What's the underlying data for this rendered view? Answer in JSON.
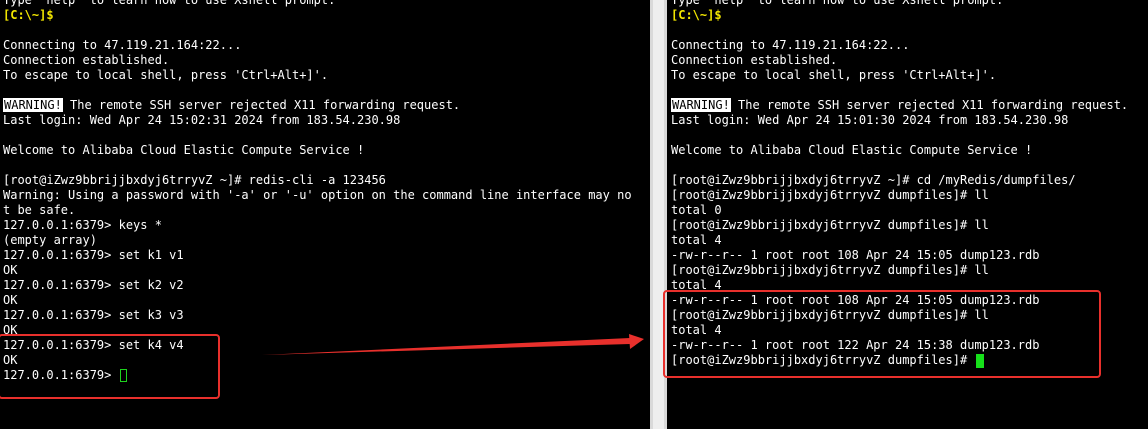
{
  "left_terminal": {
    "lines": [
      {
        "text": "Type `help' to learn how to use Xshell prompt."
      },
      {
        "text": "[C:\\~]$",
        "style": "prompt"
      },
      {
        "text": ""
      },
      {
        "text": "Connecting to 47.119.21.164:22..."
      },
      {
        "text": "Connection established."
      },
      {
        "text": "To escape to local shell, press 'Ctrl+Alt+]'."
      },
      {
        "text": ""
      },
      {
        "warning": "WARNING!",
        "text": " The remote SSH server rejected X11 forwarding request."
      },
      {
        "text": "Last login: Wed Apr 24 15:02:31 2024 from 183.54.230.98"
      },
      {
        "text": ""
      },
      {
        "text": "Welcome to Alibaba Cloud Elastic Compute Service !"
      },
      {
        "text": ""
      },
      {
        "text": "[root@iZwz9bbrijjbxdyj6trryvZ ~]# redis-cli -a 123456"
      },
      {
        "text": "Warning: Using a password with '-a' or '-u' option on the command line interface may no"
      },
      {
        "text": "t be safe."
      },
      {
        "text": "127.0.0.1:6379> keys *"
      },
      {
        "text": "(empty array)"
      },
      {
        "text": "127.0.0.1:6379> set k1 v1"
      },
      {
        "text": "OK"
      },
      {
        "text": "127.0.0.1:6379> set k2 v2"
      },
      {
        "text": "OK"
      },
      {
        "text": "127.0.0.1:6379> set k3 v3"
      },
      {
        "text": "OK"
      },
      {
        "text": "127.0.0.1:6379> set k4 v4"
      },
      {
        "text": "OK"
      },
      {
        "text": "127.0.0.1:6379> ",
        "cursor": "outline"
      }
    ]
  },
  "right_terminal": {
    "lines": [
      {
        "text": "Type `help' to learn how to use Xshell prompt."
      },
      {
        "text": "[C:\\~]$",
        "style": "prompt"
      },
      {
        "text": ""
      },
      {
        "text": "Connecting to 47.119.21.164:22..."
      },
      {
        "text": "Connection established."
      },
      {
        "text": "To escape to local shell, press 'Ctrl+Alt+]'."
      },
      {
        "text": ""
      },
      {
        "warning": "WARNING!",
        "text": " The remote SSH server rejected X11 forwarding request."
      },
      {
        "text": "Last login: Wed Apr 24 15:01:30 2024 from 183.54.230.98"
      },
      {
        "text": ""
      },
      {
        "text": "Welcome to Alibaba Cloud Elastic Compute Service !"
      },
      {
        "text": ""
      },
      {
        "text": "[root@iZwz9bbrijjbxdyj6trryvZ ~]# cd /myRedis/dumpfiles/"
      },
      {
        "text": "[root@iZwz9bbrijjbxdyj6trryvZ dumpfiles]# ll"
      },
      {
        "text": "total 0"
      },
      {
        "text": "[root@iZwz9bbrijjbxdyj6trryvZ dumpfiles]# ll"
      },
      {
        "text": "total 4"
      },
      {
        "text": "-rw-r--r-- 1 root root 108 Apr 24 15:05 dump123.rdb"
      },
      {
        "text": "[root@iZwz9bbrijjbxdyj6trryvZ dumpfiles]# ll"
      },
      {
        "text": "total 4"
      },
      {
        "text": "-rw-r--r-- 1 root root 108 Apr 24 15:05 dump123.rdb"
      },
      {
        "text": "[root@iZwz9bbrijjbxdyj6trryvZ dumpfiles]# ll"
      },
      {
        "text": "total 4"
      },
      {
        "text": "-rw-r--r-- 1 root root 122 Apr 24 15:38 dump123.rdb"
      },
      {
        "text": "[root@iZwz9bbrijjbxdyj6trryvZ dumpfiles]# ",
        "cursor": "block"
      }
    ]
  },
  "colors": {
    "background": "#000000",
    "text": "#ffffff",
    "prompt": "#f2e600",
    "cursor": "#16e01a",
    "annotation": "#e8302c"
  }
}
